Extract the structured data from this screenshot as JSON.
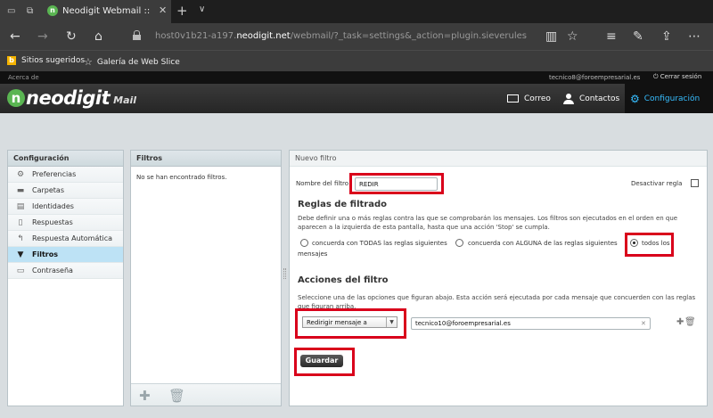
{
  "browser": {
    "tab_title": "Neodigit Webmail :: Filtr",
    "url_host": "host0v1b21-a197.",
    "url_domain": "neodigit.net",
    "url_path": "/webmail/?_task=settings&_action=plugin.sieverules",
    "favorites": [
      "Sitios sugeridos",
      "Galería de Web Slice"
    ]
  },
  "topline": {
    "about": "Acerca de",
    "user": "tecnico8@foroempresarial.es",
    "logout": "Cerrar sesión"
  },
  "header": {
    "logo_brand": "neodigit",
    "logo_sub": "Mail",
    "nav": [
      "Correo",
      "Contactos",
      "Configuración"
    ]
  },
  "settings": {
    "title": "Configuración",
    "items": [
      {
        "label": "Preferencias",
        "icon": "gear-icon"
      },
      {
        "label": "Carpetas",
        "icon": "folder-icon"
      },
      {
        "label": "Identidades",
        "icon": "identity-card-icon"
      },
      {
        "label": "Respuestas",
        "icon": "document-icon"
      },
      {
        "label": "Respuesta Automática",
        "icon": "reply-icon"
      },
      {
        "label": "Filtros",
        "icon": "funnel-icon",
        "selected": true
      },
      {
        "label": "Contraseña",
        "icon": "password-icon"
      }
    ]
  },
  "filters": {
    "title": "Filtros",
    "empty": "No se han encontrado filtros."
  },
  "editor": {
    "title": "Nuevo filtro",
    "name_label": "Nombre del filtro",
    "name_value": "REDIR",
    "disable_label": "Desactivar regla",
    "rules_heading": "Reglas de filtrado",
    "rules_desc": "Debe definir una o más reglas contra las que se comprobarán los mensajes. Los filtros son ejecutados en el orden en que aparecen a la izquierda de esta pantalla, hasta que una acción 'Stop' se cumpla.",
    "opt_all": "concuerda con TODAS las reglas siguientes",
    "opt_any": "concuerda con ALGUNA de las reglas siguientes",
    "opt_every": "todos los",
    "opt_every_wrap": "mensajes",
    "actions_heading": "Acciones del filtro",
    "actions_desc": "Seleccione una de las opciones que figuran abajo. Esta acción será ejecutada por cada mensaje que concuerden con las reglas que figuran arriba.",
    "action_select": "Redirigir mensaje a",
    "action_target": "tecnico10@foroempresarial.es",
    "save": "Guardar"
  },
  "colors": {
    "highlight": "#d9001b",
    "selected_nav": "#37beff",
    "brand_green": "#5ab552"
  }
}
